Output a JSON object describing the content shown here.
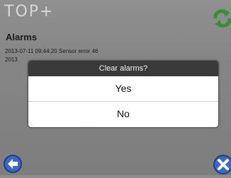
{
  "header": {
    "logo_text": "TOP+",
    "refresh_icon": "refresh-icon"
  },
  "page": {
    "title": "Alarms",
    "alarms": [
      "2013-07-11 09:44:20 Sensor error 46",
      "2013"
    ]
  },
  "dialog": {
    "title": "Clear alarms?",
    "yes_label": "Yes",
    "no_label": "No"
  },
  "footer": {
    "back_icon": "back-arrow-icon",
    "close_icon": "close-icon"
  },
  "colors": {
    "background": "#8e8e8e",
    "dialog_header": "#3a3a3a",
    "accent_green": "#3aa63a",
    "accent_blue": "#2f5fb8"
  }
}
